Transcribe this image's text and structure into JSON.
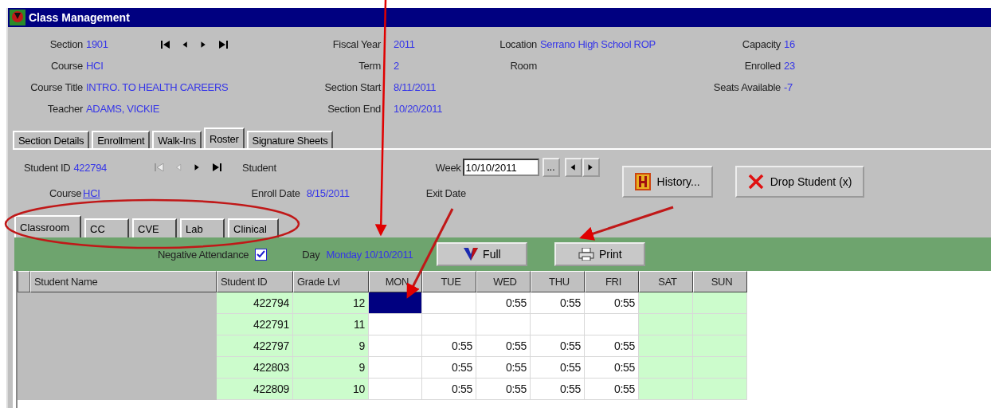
{
  "window": {
    "title": "Class Management"
  },
  "header": {
    "columns": [
      [
        {
          "label": "Section",
          "value": "1901"
        },
        {
          "label": "Course",
          "value": "HCI"
        },
        {
          "label": "Course Title",
          "value": "INTRO. TO HEALTH CAREERS"
        },
        {
          "label": "Teacher",
          "value": "ADAMS, VICKIE"
        }
      ],
      [
        {
          "label": "Fiscal Year",
          "value": "2011"
        },
        {
          "label": "Term",
          "value": "2"
        },
        {
          "label": "Section Start",
          "value": "8/11/2011"
        },
        {
          "label": "Section End",
          "value": "10/20/2011"
        }
      ],
      [
        {
          "label": "Location",
          "value": "Serrano High School ROP"
        },
        {
          "label": "Room"
        }
      ],
      [
        {
          "label": "Capacity",
          "value": "16"
        },
        {
          "label": "Enrolled",
          "value": "23"
        },
        {
          "label": "Seats Available",
          "value": "-7"
        }
      ]
    ]
  },
  "tabs": [
    {
      "label": "Section Details",
      "selected": false
    },
    {
      "label": "Enrollment",
      "selected": false
    },
    {
      "label": "Walk-Ins",
      "selected": false
    },
    {
      "label": "Roster",
      "selected": true
    },
    {
      "label": "Signature Sheets",
      "selected": false
    }
  ],
  "student": {
    "id_label": "Student ID",
    "id": "422794",
    "nav_disabled": [
      true,
      true,
      false,
      false
    ],
    "student_label": "Student",
    "course_label": "Course",
    "course": "HCI",
    "enroll_label": "Enroll Date",
    "enroll_date": "8/15/2011",
    "exit_label": "Exit Date"
  },
  "week": {
    "label": "Week",
    "value": "10/10/2011",
    "browse": "..."
  },
  "buttons": [
    {
      "label": "History...",
      "kind": "history"
    },
    {
      "label": "Drop Student (x)",
      "kind": "drop"
    }
  ],
  "subtabs": [
    {
      "label": "Classroom",
      "selected": true
    },
    {
      "label": "CC",
      "selected": false
    },
    {
      "label": "CVE",
      "selected": false
    },
    {
      "label": "Lab",
      "selected": false
    },
    {
      "label": "Clinical",
      "selected": false
    }
  ],
  "attendance_bar": {
    "negative_label": "Negative Attendance",
    "negative_checked": true,
    "day_label": "Day",
    "day": "Monday 10/10/2011",
    "full_button": "Full",
    "print_button": "Print"
  },
  "table": {
    "columns": [
      {
        "label": "Student Name",
        "kind": "name"
      },
      {
        "label": "Student ID",
        "kind": "info"
      },
      {
        "label": "Grade Lvl",
        "kind": "info"
      },
      {
        "label": "MON",
        "kind": "day"
      },
      {
        "label": "TUE",
        "kind": "day"
      },
      {
        "label": "WED",
        "kind": "day"
      },
      {
        "label": "THU",
        "kind": "day"
      },
      {
        "label": "FRI",
        "kind": "day"
      },
      {
        "label": "SAT",
        "kind": "weekend"
      },
      {
        "label": "SUN",
        "kind": "weekend"
      }
    ],
    "rows": [
      {
        "student_id": "422794",
        "grade": "12",
        "days": [
          {
            "selected": true
          },
          {
            "selected": false
          },
          {
            "value": "0:55",
            "selected": false
          },
          {
            "value": "0:55",
            "selected": false
          },
          {
            "value": "0:55",
            "selected": false
          },
          {
            "selected": false
          },
          {
            "selected": false
          }
        ]
      },
      {
        "student_id": "422791",
        "grade": "11",
        "days": [
          {
            "selected": false
          },
          {
            "selected": false
          },
          {
            "selected": false
          },
          {
            "selected": false
          },
          {
            "selected": false
          },
          {
            "selected": false
          },
          {
            "selected": false
          }
        ]
      },
      {
        "student_id": "422797",
        "grade": "9",
        "days": [
          {
            "selected": false
          },
          {
            "value": "0:55",
            "selected": false
          },
          {
            "value": "0:55",
            "selected": false
          },
          {
            "value": "0:55",
            "selected": false
          },
          {
            "value": "0:55",
            "selected": false
          },
          {
            "selected": false
          },
          {
            "selected": false
          }
        ]
      },
      {
        "student_id": "422803",
        "grade": "9",
        "days": [
          {
            "selected": false
          },
          {
            "value": "0:55",
            "selected": false
          },
          {
            "value": "0:55",
            "selected": false
          },
          {
            "value": "0:55",
            "selected": false
          },
          {
            "value": "0:55",
            "selected": false
          },
          {
            "selected": false
          },
          {
            "selected": false
          }
        ]
      },
      {
        "student_id": "422809",
        "grade": "10",
        "days": [
          {
            "selected": false
          },
          {
            "value": "0:55",
            "selected": false
          },
          {
            "value": "0:55",
            "selected": false
          },
          {
            "value": "0:55",
            "selected": false
          },
          {
            "value": "0:55",
            "selected": false
          },
          {
            "selected": false
          },
          {
            "selected": false
          }
        ]
      }
    ]
  }
}
